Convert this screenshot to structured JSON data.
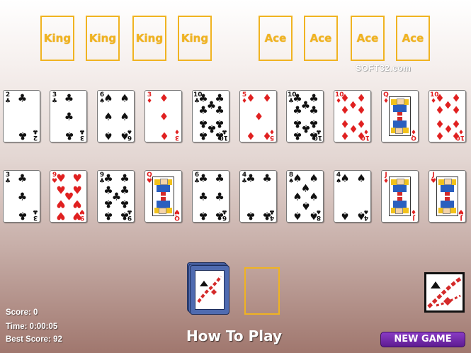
{
  "foundations": {
    "king_slots": [
      "King",
      "King",
      "King",
      "King"
    ],
    "ace_slots": [
      "Ace",
      "Ace",
      "Ace",
      "Ace"
    ]
  },
  "watermark": "SOFT32.com",
  "tableau": {
    "row1": [
      {
        "rank": "2",
        "suit": "clubs"
      },
      {
        "rank": "3",
        "suit": "clubs"
      },
      {
        "rank": "6",
        "suit": "spades"
      },
      {
        "rank": "3",
        "suit": "diamonds"
      },
      {
        "rank": "10",
        "suit": "clubs"
      },
      {
        "rank": "5",
        "suit": "diamonds"
      },
      {
        "rank": "10",
        "suit": "clubs"
      },
      {
        "rank": "10",
        "suit": "diamonds"
      },
      {
        "rank": "Q",
        "suit": "diamonds"
      },
      {
        "rank": "10",
        "suit": "diamonds"
      }
    ],
    "row2": [
      {
        "rank": "3",
        "suit": "clubs"
      },
      {
        "rank": "9",
        "suit": "hearts"
      },
      {
        "rank": "9",
        "suit": "clubs"
      },
      {
        "rank": "Q",
        "suit": "hearts"
      },
      {
        "rank": "6",
        "suit": "clubs"
      },
      {
        "rank": "4",
        "suit": "clubs"
      },
      {
        "rank": "8",
        "suit": "spades"
      },
      {
        "rank": "4",
        "suit": "spades"
      },
      {
        "rank": "J",
        "suit": "diamonds"
      },
      {
        "rank": "J",
        "suit": "hearts"
      }
    ]
  },
  "stats": {
    "score": "Score: 0",
    "time": "Time: 0:00:05",
    "best_score": "Best Score: 92"
  },
  "how_to_play": "How To Play",
  "new_game": "NEW GAME",
  "colors": {
    "slot_border": "#f0b321",
    "red_suit": "#e02020",
    "black_suit": "#111111",
    "deck_back": "#4f6bb0",
    "new_game_bg": "#6a2aa0"
  }
}
